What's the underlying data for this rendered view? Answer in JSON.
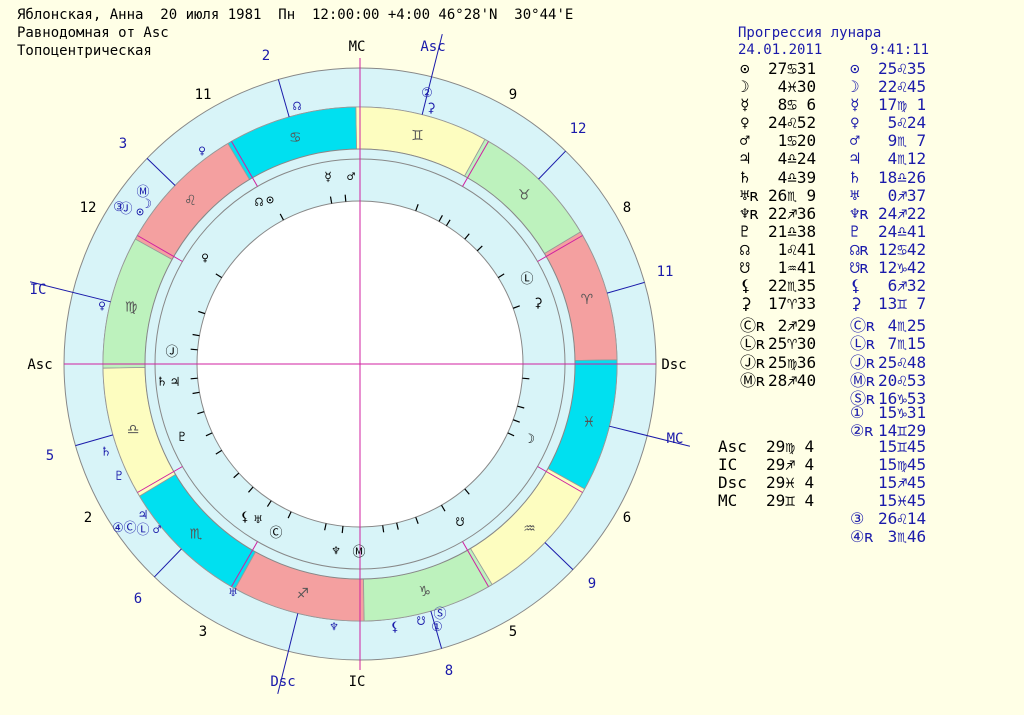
{
  "header": {
    "line1": "Яблонская, Анна  20 июля 1981  Пн  12:00:00 +4:00 46°28'N  30°44'E",
    "line2": "Равнодомная от Asc",
    "line3": "Топоцентрическая"
  },
  "progression": {
    "title": "Прогрессия лунара",
    "date": "24.01.2011",
    "time": "9:41:11"
  },
  "natal_positions": [
    {
      "glyph": "⊙",
      "pos": "27♋31"
    },
    {
      "glyph": "☽",
      "pos": " 4♓30"
    },
    {
      "glyph": "☿",
      "pos": " 8♋ 6"
    },
    {
      "glyph": "♀",
      "pos": "24♌52"
    },
    {
      "glyph": "♂",
      "pos": " 1♋20"
    },
    {
      "glyph": "♃",
      "pos": " 4♎24"
    },
    {
      "glyph": "♄",
      "pos": " 4♎39"
    },
    {
      "glyph": "♅ʀ",
      "pos": "26♏ 9"
    },
    {
      "glyph": "♆ʀ",
      "pos": "22♐36"
    },
    {
      "glyph": "♇",
      "pos": "21♎38"
    },
    {
      "glyph": "☊",
      "pos": " 1♌41"
    },
    {
      "glyph": "☋",
      "pos": " 1♒41"
    },
    {
      "glyph": "⚸",
      "pos": "22♏35"
    },
    {
      "glyph": "⚳",
      "pos": "17♈33"
    },
    {
      "glyph": "Ⓒʀ",
      "pos": " 2♐29"
    },
    {
      "glyph": "Ⓛʀ",
      "pos": "25♈30"
    },
    {
      "glyph": "Ⓙʀ",
      "pos": "25♍36"
    },
    {
      "glyph": "Ⓜʀ",
      "pos": "28♐40"
    }
  ],
  "progressed_positions": [
    {
      "glyph": "⊙",
      "pos": "25♌35"
    },
    {
      "glyph": "☽",
      "pos": "22♌45"
    },
    {
      "glyph": "☿",
      "pos": "17♍ 1"
    },
    {
      "glyph": "♀",
      "pos": " 5♌24"
    },
    {
      "glyph": "♂",
      "pos": " 9♏ 7"
    },
    {
      "glyph": "♃",
      "pos": " 4♏12"
    },
    {
      "glyph": "♄",
      "pos": "18♎26"
    },
    {
      "glyph": "♅",
      "pos": " 0♐37"
    },
    {
      "glyph": "♆ʀ",
      "pos": "24♐22"
    },
    {
      "glyph": "♇",
      "pos": "24♎41"
    },
    {
      "glyph": "☊ʀ",
      "pos": "12♋42"
    },
    {
      "glyph": "☋ʀ",
      "pos": "12♑42"
    },
    {
      "glyph": "⚸",
      "pos": " 6♐32"
    },
    {
      "glyph": "⚳",
      "pos": "13♊ 7"
    },
    {
      "glyph": "Ⓒʀ",
      "pos": " 4♏25"
    },
    {
      "glyph": "Ⓛʀ",
      "pos": " 7♏15"
    },
    {
      "glyph": "Ⓙʀ",
      "pos": "25♌48"
    },
    {
      "glyph": "Ⓜʀ",
      "pos": "20♌53"
    },
    {
      "glyph": "Ⓢʀ",
      "pos": "16♑53"
    },
    {
      "glyph": "①",
      "pos": "15♑31"
    },
    {
      "glyph": "②ʀ",
      "pos": "14♊29"
    }
  ],
  "natal_angles": [
    {
      "label": "Asc",
      "pos": "29♍ 4"
    },
    {
      "label": "IC",
      "pos": "29♐ 4"
    },
    {
      "label": "Dsc",
      "pos": "29♓ 4"
    },
    {
      "label": "MC",
      "pos": "29♊ 4"
    }
  ],
  "progressed_angles": [
    {
      "pos": "15♊45"
    },
    {
      "pos": "15♍45"
    },
    {
      "pos": "15♐45"
    },
    {
      "pos": "15♓45"
    }
  ],
  "extra_points": [
    {
      "glyph": "③",
      "pos": "26♌14"
    },
    {
      "glyph": "④ʀ",
      "pos": " 3♏46"
    }
  ],
  "chart": {
    "center_labels": {
      "mc": "MC",
      "ic": "IC",
      "asc": "Asc",
      "dsc": "Dsc"
    },
    "outer_house_numbers_black": [
      "11",
      "12",
      "2",
      "3"
    ],
    "outer_house_numbers_blue": [
      "2",
      "3",
      "12",
      "11",
      "5",
      "6",
      "9",
      "8"
    ],
    "inner_angle_labels": {
      "asc": "Asc",
      "mc": "MC",
      "dsc": "Dsc",
      "ic": "IC"
    },
    "inner_house_numbers": [
      "9",
      "8",
      "6",
      "5"
    ],
    "sign_colors": {
      "fire": "#f4a0a0",
      "earth": "#bdf2bd",
      "air": "#fdfdc0",
      "water": "#00e0f0"
    },
    "ring_color": "#d8f4f8"
  }
}
